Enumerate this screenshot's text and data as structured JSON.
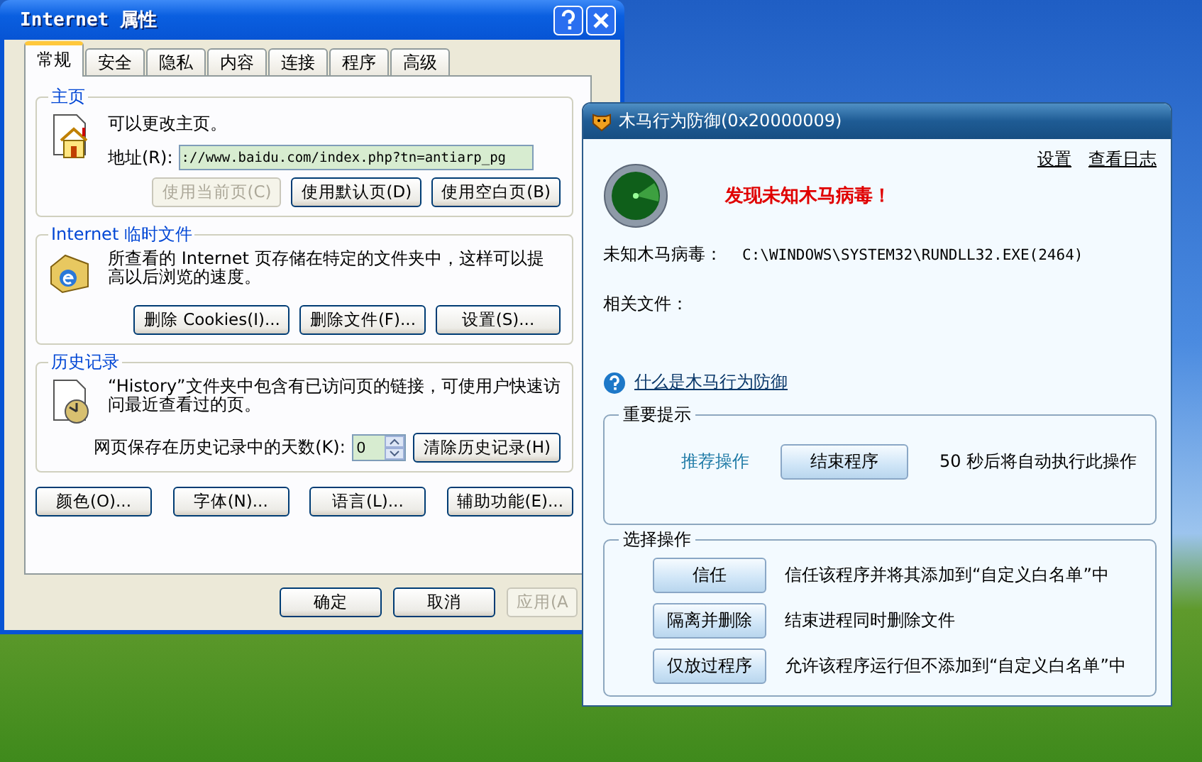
{
  "ie_dialog": {
    "title": "Internet 属性",
    "tabs": [
      {
        "label": "常规",
        "selected": true
      },
      {
        "label": "安全",
        "selected": false
      },
      {
        "label": "隐私",
        "selected": false
      },
      {
        "label": "内容",
        "selected": false
      },
      {
        "label": "连接",
        "selected": false
      },
      {
        "label": "程序",
        "selected": false
      },
      {
        "label": "高级",
        "selected": false
      }
    ],
    "homepage": {
      "legend": "主页",
      "text": "可以更改主页。",
      "address_label": "地址(R):",
      "address_value": "://www.baidu.com/index.php?tn=antiarp_pg",
      "buttons": [
        {
          "label": "使用当前页(C)",
          "disabled": true
        },
        {
          "label": "使用默认页(D)",
          "disabled": false
        },
        {
          "label": "使用空白页(B)",
          "disabled": false
        }
      ]
    },
    "temp_files": {
      "legend": "Internet 临时文件",
      "text": "所查看的 Internet 页存储在特定的文件夹中，这样可以提高以后浏览的速度。",
      "buttons": [
        {
          "label": "删除 Cookies(I)...",
          "disabled": false
        },
        {
          "label": "删除文件(F)...",
          "disabled": false
        },
        {
          "label": "设置(S)...",
          "disabled": false
        }
      ]
    },
    "history": {
      "legend": "历史记录",
      "text": "“History”文件夹中包含有已访问页的链接，可使用户快速访问最近查看过的页。",
      "days_label": "网页保存在历史记录中的天数(K):",
      "days_value": "0",
      "clear_button": "清除历史记录(H)"
    },
    "extra_buttons": [
      {
        "label": "颜色(O)...",
        "disabled": false
      },
      {
        "label": "字体(N)...",
        "disabled": false
      },
      {
        "label": "语言(L)...",
        "disabled": false
      },
      {
        "label": "辅助功能(E)...",
        "disabled": false
      }
    ],
    "dialog_buttons": [
      {
        "label": "确定",
        "disabled": false
      },
      {
        "label": "取消",
        "disabled": false
      },
      {
        "label": "应用(A",
        "disabled": true
      }
    ]
  },
  "trojan_window": {
    "title": "木马行为防御(0x20000009)",
    "links": [
      "设置",
      "查看日志"
    ],
    "alert": "发现未知木马病毒！",
    "virus_label": "未知木马病毒：",
    "virus_path": "C:\\WINDOWS\\SYSTEM32\\RUNDLL32.EXE(2464)",
    "related_label": "相关文件：",
    "help_link": "什么是木马行为防御",
    "important": {
      "legend": "重要提示",
      "recommend_label": "推荐操作",
      "button": "结束程序",
      "countdown": "50 秒后将自动执行此操作"
    },
    "choices": {
      "legend": "选择操作",
      "options": [
        {
          "button": "信任",
          "description": "信任该程序并将其添加到“自定义白名单”中"
        },
        {
          "button": "隔离并删除",
          "description": "结束进程同时删除文件"
        },
        {
          "button": "仅放过程序",
          "description": "允许该程序运行但不添加到“自定义白名单”中"
        }
      ]
    }
  }
}
